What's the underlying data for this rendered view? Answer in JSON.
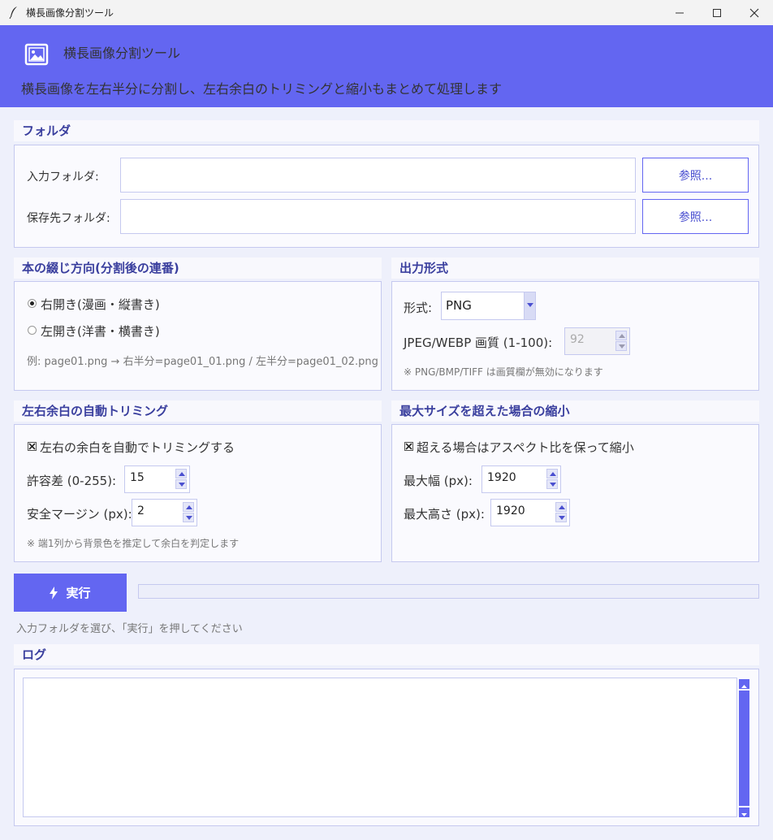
{
  "window": {
    "title": "横長画像分割ツール"
  },
  "header": {
    "title": "横長画像分割ツール",
    "subtitle": "横長画像を左右半分に分割し、左右余白のトリミングと縮小もまとめて処理します"
  },
  "folders": {
    "section_title": "フォルダ",
    "input_label": "入力フォルダ:",
    "input_value": "",
    "output_label": "保存先フォルダ:",
    "output_value": "",
    "browse_label": "参照..."
  },
  "binding": {
    "section_title": "本の綴じ方向(分割後の連番)",
    "options": [
      {
        "label": "右開き(漫画・縦書き)",
        "selected": true
      },
      {
        "label": "左開き(洋書・横書き)",
        "selected": false
      }
    ],
    "example": "例: page01.png → 右半分=page01_01.png / 左半分=page01_02.png"
  },
  "output_format": {
    "section_title": "出力形式",
    "format_label": "形式:",
    "format_value": "PNG",
    "quality_label": "JPEG/WEBP 画質 (1-100):",
    "quality_value": "92",
    "note": "※ PNG/BMP/TIFF は画質欄が無効になります"
  },
  "trimming": {
    "section_title": "左右余白の自動トリミング",
    "enable_label": "左右の余白を自動でトリミングする",
    "enabled": true,
    "tolerance_label": "許容差 (0-255):",
    "tolerance_value": "15",
    "margin_label": "安全マージン (px):",
    "margin_value": "2",
    "note": "※ 端1列から背景色を推定して余白を判定します"
  },
  "resize": {
    "section_title": "最大サイズを超えた場合の縮小",
    "enable_label": "超える場合はアスペクト比を保って縮小",
    "enabled": true,
    "max_width_label": "最大幅 (px):",
    "max_width_value": "1920",
    "max_height_label": "最大高さ (px):",
    "max_height_value": "1920"
  },
  "run": {
    "label": "実行",
    "progress": 0,
    "status": "入力フォルダを選び、「実行」を押してください"
  },
  "log": {
    "section_title": "ログ",
    "content": ""
  },
  "colors": {
    "accent": "#6366f1",
    "header_text": "#ffffff",
    "section_title": "#3a3f9e"
  },
  "icons": {
    "app": "feather-icon",
    "logo": "picture-frame-icon",
    "run": "lightning-icon"
  }
}
